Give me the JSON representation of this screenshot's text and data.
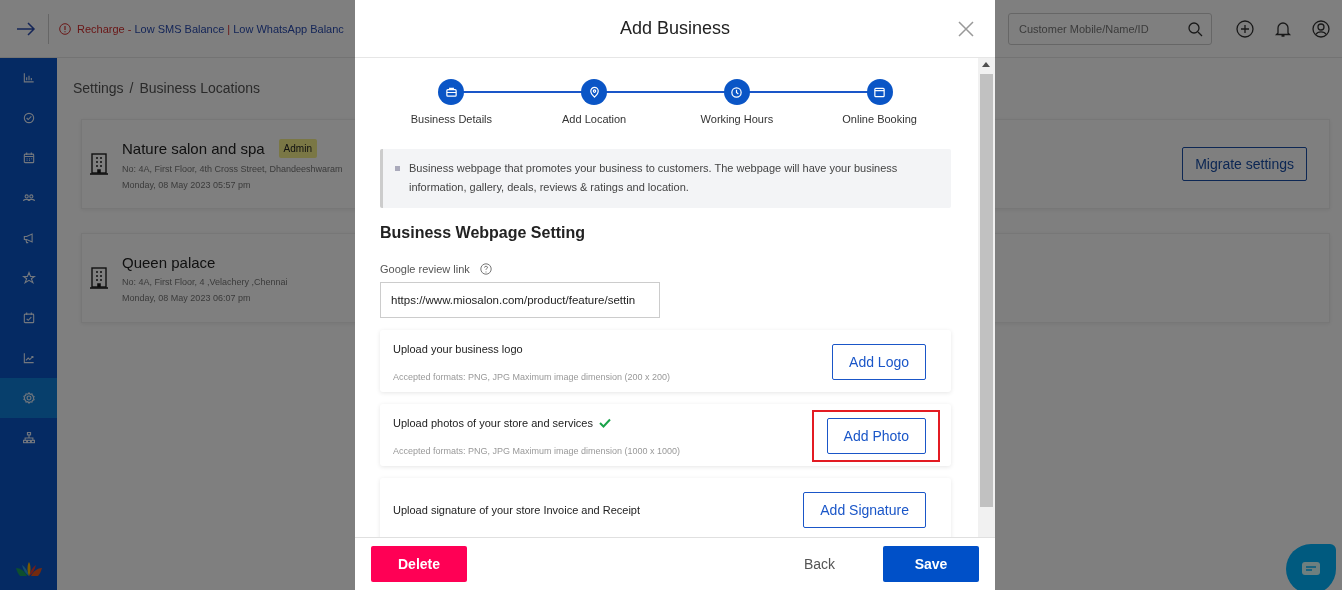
{
  "topbar": {
    "banner": {
      "prefix": "Recharge - ",
      "links": [
        "Low SMS Balance",
        "Low WhatsApp Balanc"
      ],
      "separator": "|"
    },
    "search": {
      "placeholder": "Customer Mobile/Name/ID"
    }
  },
  "sidebar": {
    "items": [
      {
        "selected": false
      },
      {
        "selected": false
      },
      {
        "selected": false
      },
      {
        "selected": false
      },
      {
        "selected": false
      },
      {
        "selected": false
      },
      {
        "selected": false
      },
      {
        "selected": false
      },
      {
        "selected": true
      },
      {
        "selected": false
      }
    ]
  },
  "breadcrumb": {
    "items": [
      "Settings",
      "Business Locations"
    ],
    "separator": "/"
  },
  "locations": [
    {
      "name": "Nature salon and spa",
      "badge": "Admin",
      "address": "No: 4A, First Floor, 4th Cross Street, Dhandeeshwaram",
      "date": "Monday, 08 May 2023 05:57 pm"
    },
    {
      "name": "Queen palace",
      "address": "No: 4A, First Floor, 4 ,Velachery ,Chennai",
      "date": "Monday, 08 May 2023 06:07 pm"
    }
  ],
  "migrate_button": "Migrate settings",
  "modal": {
    "title": "Add Business",
    "steps": [
      {
        "label": "Business Details"
      },
      {
        "label": "Add Location"
      },
      {
        "label": "Working Hours"
      },
      {
        "label": "Online Booking"
      }
    ],
    "info": "Business webpage that promotes your business to customers. The webpage will have your business information, gallery, deals, reviews & ratings and location.",
    "section_title": "Business Webpage Setting",
    "review_link": {
      "label": "Google review link",
      "value": "https://www.miosalon.com/product/feature/settin"
    },
    "uploads": [
      {
        "title": "Upload your business logo",
        "verified": false,
        "hint": "Accepted formats: PNG, JPG Maximum image dimension (200 x 200)",
        "button": "Add Logo",
        "highlighted": false
      },
      {
        "title": "Upload photos of your store and services",
        "verified": true,
        "hint": "Accepted formats: PNG, JPG Maximum image dimension (1000 x 1000)",
        "button": "Add Photo",
        "highlighted": true
      },
      {
        "title": "Upload signature of your store Invoice and Receipt",
        "verified": false,
        "button": "Add Signature",
        "highlighted": false
      }
    ],
    "footer": {
      "delete": "Delete",
      "back": "Back",
      "save": "Save"
    }
  }
}
